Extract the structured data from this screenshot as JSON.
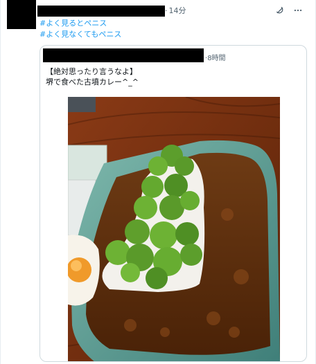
{
  "tweet": {
    "time": "14分",
    "hashtags": [
      "#よく見るとペニス",
      "#よく見なくてもペニス"
    ]
  },
  "quote": {
    "time": "8時間",
    "text_line1": "【絶対思ったり言うなよ】",
    "text_line2": "堺で食べた古墳カレー^_^"
  },
  "icons": [
    "grok-icon",
    "more-icon"
  ]
}
